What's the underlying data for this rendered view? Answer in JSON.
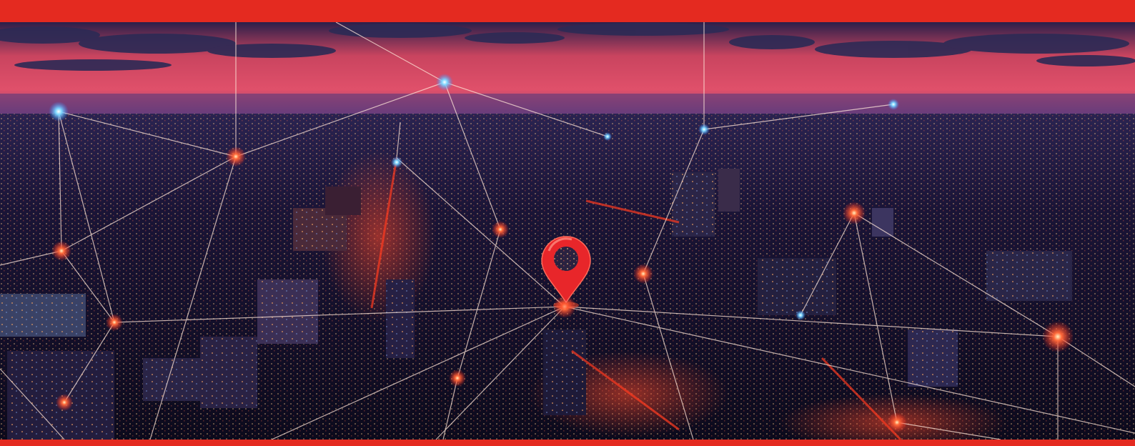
{
  "colors": {
    "brand_red": "#e42a20",
    "sky_top": "#2a1f4a",
    "sky_glow": "#e0506a",
    "horizon": "#7a4a8a",
    "city_dark": "#120d24",
    "node_red": "#ff3b2f",
    "node_blue": "#7fd8ff",
    "pin_red": "#e8262a"
  },
  "hero_image": {
    "scene": "night-city-aerial",
    "icon": "map-pin-icon"
  }
}
